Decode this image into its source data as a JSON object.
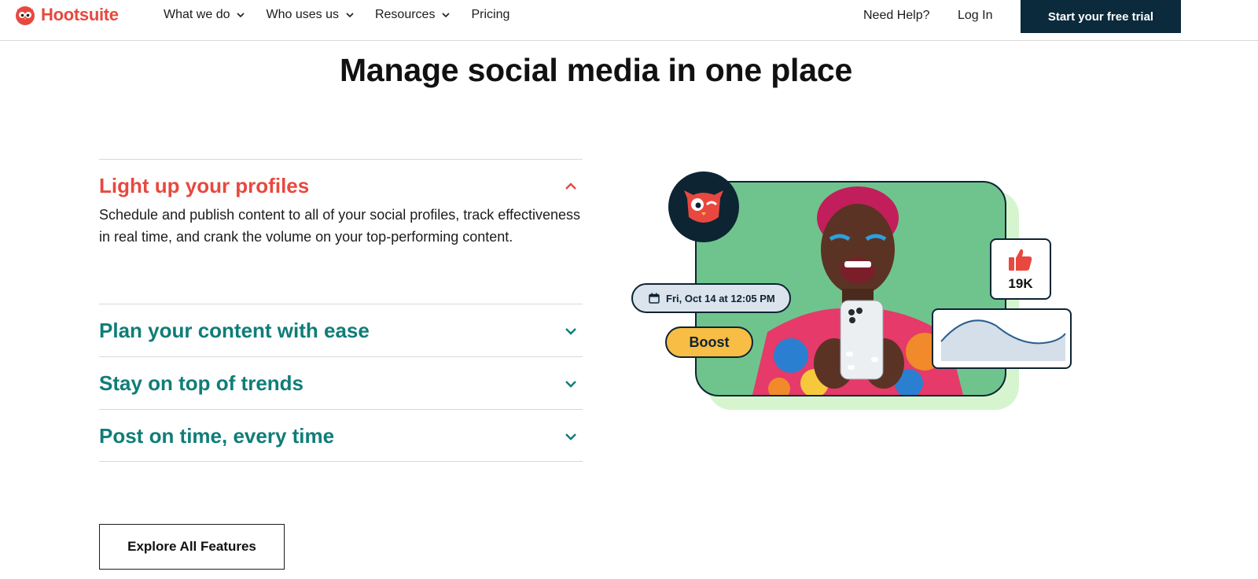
{
  "header": {
    "brand": "Hootsuite",
    "nav": [
      {
        "label": "What we do",
        "has_dropdown": true
      },
      {
        "label": "Who uses us",
        "has_dropdown": true
      },
      {
        "label": "Resources",
        "has_dropdown": true
      },
      {
        "label": "Pricing",
        "has_dropdown": false
      }
    ],
    "help_label": "Need Help?",
    "login_label": "Log In",
    "cta_label": "Start your free trial"
  },
  "main": {
    "title": "Manage social media in one place",
    "accordion": [
      {
        "title": "Light up your profiles",
        "expanded": true,
        "body": "Schedule and publish content to all of your social profiles, track effectiveness in real time, and crank the volume on your top-performing content."
      },
      {
        "title": "Plan your content with ease",
        "expanded": false
      },
      {
        "title": "Stay on top of trends",
        "expanded": false
      },
      {
        "title": "Post on time, every time",
        "expanded": false
      }
    ],
    "explore_label": "Explore All Features",
    "illustration": {
      "date_label": "Fri, Oct 14 at 12:05 PM",
      "boost_label": "Boost",
      "likes_label": "19K"
    }
  },
  "colors": {
    "brand_red": "#e8483f",
    "teal": "#0f7d78",
    "navy": "#0b2a3c",
    "photo_green": "#6fc48e",
    "boost_yellow": "#f7bd45"
  },
  "icons": [
    "owl-logo-icon",
    "chevron-down-icon",
    "chevron-up-icon",
    "calendar-icon",
    "thumbs-up-icon"
  ]
}
